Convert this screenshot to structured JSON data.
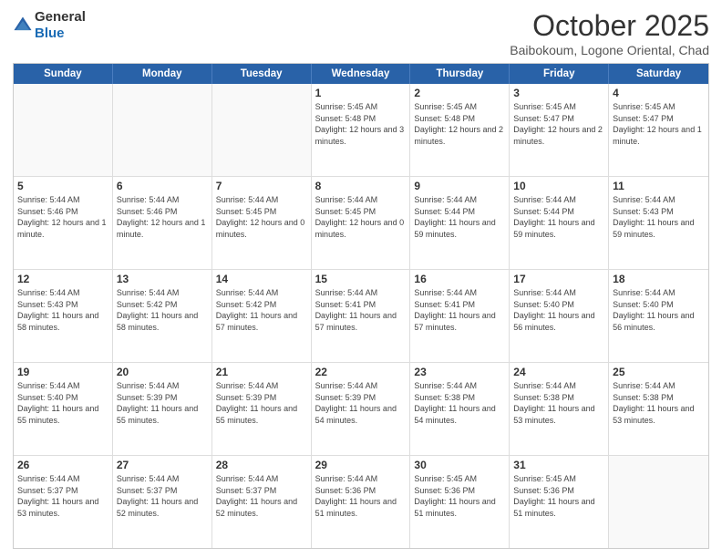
{
  "header": {
    "logo_general": "General",
    "logo_blue": "Blue",
    "title": "October 2025",
    "subtitle": "Baibokoum, Logone Oriental, Chad"
  },
  "days_of_week": [
    "Sunday",
    "Monday",
    "Tuesday",
    "Wednesday",
    "Thursday",
    "Friday",
    "Saturday"
  ],
  "weeks": [
    [
      {
        "day": "",
        "info": ""
      },
      {
        "day": "",
        "info": ""
      },
      {
        "day": "",
        "info": ""
      },
      {
        "day": "1",
        "info": "Sunrise: 5:45 AM\nSunset: 5:48 PM\nDaylight: 12 hours and 3 minutes."
      },
      {
        "day": "2",
        "info": "Sunrise: 5:45 AM\nSunset: 5:48 PM\nDaylight: 12 hours and 2 minutes."
      },
      {
        "day": "3",
        "info": "Sunrise: 5:45 AM\nSunset: 5:47 PM\nDaylight: 12 hours and 2 minutes."
      },
      {
        "day": "4",
        "info": "Sunrise: 5:45 AM\nSunset: 5:47 PM\nDaylight: 12 hours and 1 minute."
      }
    ],
    [
      {
        "day": "5",
        "info": "Sunrise: 5:44 AM\nSunset: 5:46 PM\nDaylight: 12 hours and 1 minute."
      },
      {
        "day": "6",
        "info": "Sunrise: 5:44 AM\nSunset: 5:46 PM\nDaylight: 12 hours and 1 minute."
      },
      {
        "day": "7",
        "info": "Sunrise: 5:44 AM\nSunset: 5:45 PM\nDaylight: 12 hours and 0 minutes."
      },
      {
        "day": "8",
        "info": "Sunrise: 5:44 AM\nSunset: 5:45 PM\nDaylight: 12 hours and 0 minutes."
      },
      {
        "day": "9",
        "info": "Sunrise: 5:44 AM\nSunset: 5:44 PM\nDaylight: 11 hours and 59 minutes."
      },
      {
        "day": "10",
        "info": "Sunrise: 5:44 AM\nSunset: 5:44 PM\nDaylight: 11 hours and 59 minutes."
      },
      {
        "day": "11",
        "info": "Sunrise: 5:44 AM\nSunset: 5:43 PM\nDaylight: 11 hours and 59 minutes."
      }
    ],
    [
      {
        "day": "12",
        "info": "Sunrise: 5:44 AM\nSunset: 5:43 PM\nDaylight: 11 hours and 58 minutes."
      },
      {
        "day": "13",
        "info": "Sunrise: 5:44 AM\nSunset: 5:42 PM\nDaylight: 11 hours and 58 minutes."
      },
      {
        "day": "14",
        "info": "Sunrise: 5:44 AM\nSunset: 5:42 PM\nDaylight: 11 hours and 57 minutes."
      },
      {
        "day": "15",
        "info": "Sunrise: 5:44 AM\nSunset: 5:41 PM\nDaylight: 11 hours and 57 minutes."
      },
      {
        "day": "16",
        "info": "Sunrise: 5:44 AM\nSunset: 5:41 PM\nDaylight: 11 hours and 57 minutes."
      },
      {
        "day": "17",
        "info": "Sunrise: 5:44 AM\nSunset: 5:40 PM\nDaylight: 11 hours and 56 minutes."
      },
      {
        "day": "18",
        "info": "Sunrise: 5:44 AM\nSunset: 5:40 PM\nDaylight: 11 hours and 56 minutes."
      }
    ],
    [
      {
        "day": "19",
        "info": "Sunrise: 5:44 AM\nSunset: 5:40 PM\nDaylight: 11 hours and 55 minutes."
      },
      {
        "day": "20",
        "info": "Sunrise: 5:44 AM\nSunset: 5:39 PM\nDaylight: 11 hours and 55 minutes."
      },
      {
        "day": "21",
        "info": "Sunrise: 5:44 AM\nSunset: 5:39 PM\nDaylight: 11 hours and 55 minutes."
      },
      {
        "day": "22",
        "info": "Sunrise: 5:44 AM\nSunset: 5:39 PM\nDaylight: 11 hours and 54 minutes."
      },
      {
        "day": "23",
        "info": "Sunrise: 5:44 AM\nSunset: 5:38 PM\nDaylight: 11 hours and 54 minutes."
      },
      {
        "day": "24",
        "info": "Sunrise: 5:44 AM\nSunset: 5:38 PM\nDaylight: 11 hours and 53 minutes."
      },
      {
        "day": "25",
        "info": "Sunrise: 5:44 AM\nSunset: 5:38 PM\nDaylight: 11 hours and 53 minutes."
      }
    ],
    [
      {
        "day": "26",
        "info": "Sunrise: 5:44 AM\nSunset: 5:37 PM\nDaylight: 11 hours and 53 minutes."
      },
      {
        "day": "27",
        "info": "Sunrise: 5:44 AM\nSunset: 5:37 PM\nDaylight: 11 hours and 52 minutes."
      },
      {
        "day": "28",
        "info": "Sunrise: 5:44 AM\nSunset: 5:37 PM\nDaylight: 11 hours and 52 minutes."
      },
      {
        "day": "29",
        "info": "Sunrise: 5:44 AM\nSunset: 5:36 PM\nDaylight: 11 hours and 51 minutes."
      },
      {
        "day": "30",
        "info": "Sunrise: 5:45 AM\nSunset: 5:36 PM\nDaylight: 11 hours and 51 minutes."
      },
      {
        "day": "31",
        "info": "Sunrise: 5:45 AM\nSunset: 5:36 PM\nDaylight: 11 hours and 51 minutes."
      },
      {
        "day": "",
        "info": ""
      }
    ]
  ]
}
